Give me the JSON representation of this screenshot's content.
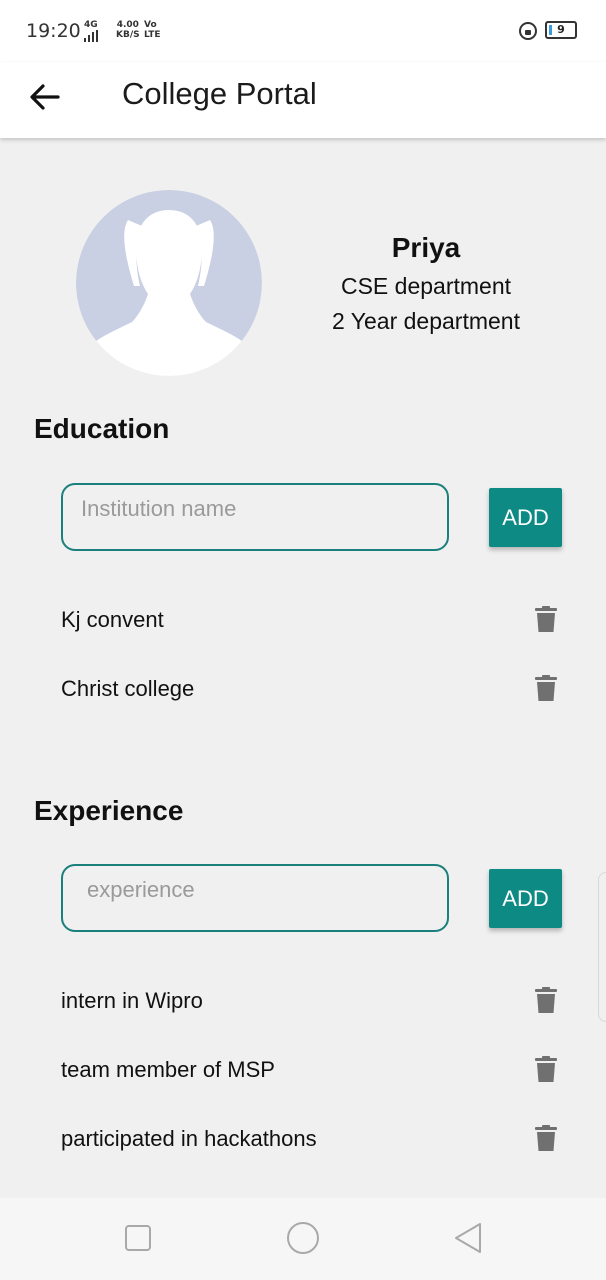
{
  "status_bar": {
    "time": "19:20",
    "network": "4G",
    "speed_value": "4.00",
    "speed_unit": "KB/S",
    "volte_top": "Vo",
    "volte_bottom": "LTE",
    "battery": "9"
  },
  "app_bar": {
    "back_icon": "arrow-left-icon",
    "title": "College Portal"
  },
  "profile": {
    "avatar_icon": "person-silhouette-icon",
    "name": "Priya",
    "department": "CSE department",
    "year": "2 Year department"
  },
  "education": {
    "title": "Education",
    "input_placeholder": "Institution name",
    "input_value": "",
    "add_label": "ADD",
    "items": [
      {
        "label": "Kj convent",
        "icon": "trash-icon"
      },
      {
        "label": "Christ college",
        "icon": "trash-icon"
      }
    ]
  },
  "experience": {
    "title": "Experience",
    "input_placeholder": "experience",
    "input_value": "",
    "add_label": "ADD",
    "items": [
      {
        "label": "intern in Wipro",
        "icon": "trash-icon"
      },
      {
        "label": "team member of MSP",
        "icon": "trash-icon"
      },
      {
        "label": "participated in hackathons",
        "icon": "trash-icon"
      }
    ]
  },
  "nav_bar": {
    "recents_icon": "square-icon",
    "home_icon": "circle-icon",
    "back_icon": "triangle-back-icon"
  },
  "colors": {
    "accent": "#0e8a84",
    "input_border": "#1b7f7c",
    "background": "#f0f0f0",
    "avatar": "#c9d0e3",
    "trash": "#707070"
  }
}
